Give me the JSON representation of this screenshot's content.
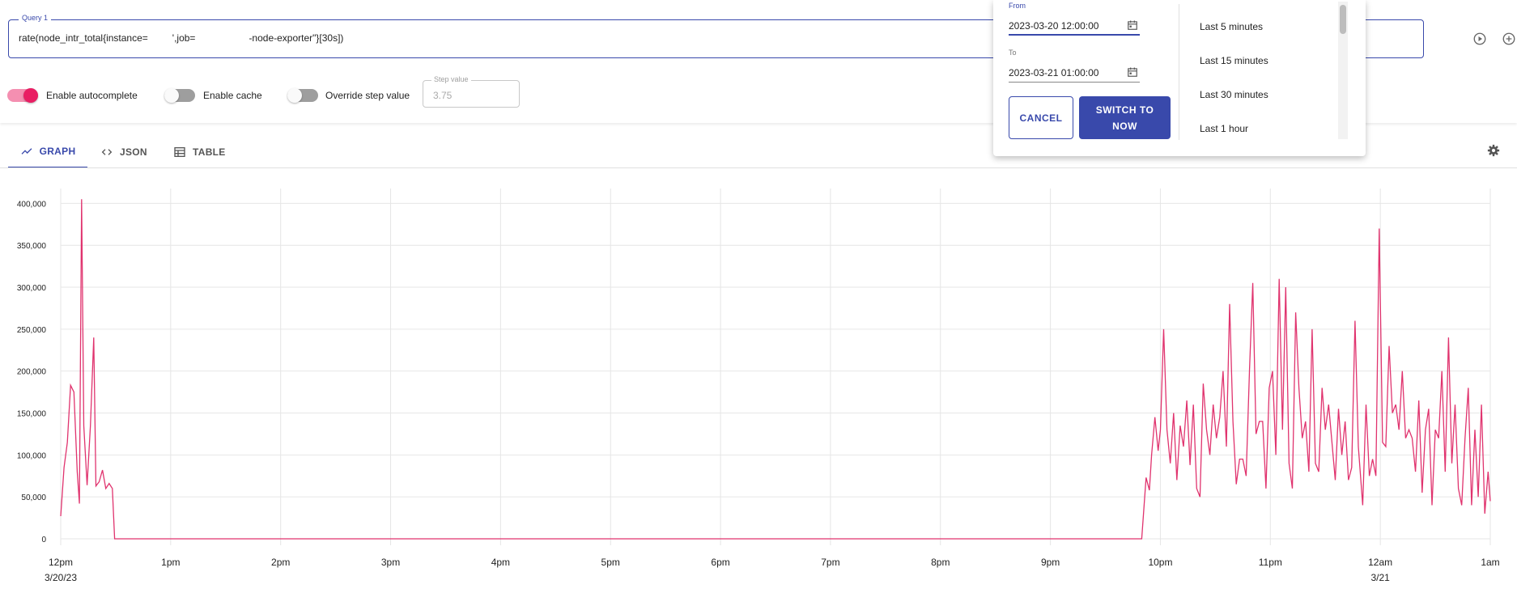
{
  "query": {
    "label": "Query 1",
    "expression_parts": [
      "rate(node_intr_total{instance=",
      "',job=",
      "-node-exporter\"}[30s])"
    ]
  },
  "options": {
    "autocomplete_label": "Enable autocomplete",
    "autocomplete_on": true,
    "cache_label": "Enable cache",
    "cache_on": false,
    "override_step_label": "Override step value",
    "override_step_on": false,
    "step_value_label": "Step value",
    "step_value_placeholder": "3.75"
  },
  "tabs": [
    {
      "label": "GRAPH",
      "icon": "trending-up-icon",
      "active": true
    },
    {
      "label": "JSON",
      "icon": "code-icon",
      "active": false
    },
    {
      "label": "TABLE",
      "icon": "table-icon",
      "active": false
    }
  ],
  "time_picker": {
    "from_label": "From",
    "from_value": "2023-03-20 12:00:00",
    "to_label": "To",
    "to_value": "2023-03-21 01:00:00",
    "cancel_label": "CANCEL",
    "switch_label": "SWITCH TO NOW",
    "ranges": [
      "Last 5 minutes",
      "Last 15 minutes",
      "Last 30 minutes",
      "Last 1 hour"
    ]
  },
  "colors": {
    "accent": "#3949ab",
    "series": "#e0336e",
    "toggle_on": "#f06292",
    "toggle_on_knob": "#e91e63"
  },
  "chart_data": {
    "type": "line",
    "ylim": [
      0,
      410000
    ],
    "yticks": [
      0,
      50000,
      100000,
      150000,
      200000,
      250000,
      300000,
      350000,
      400000
    ],
    "ytick_labels": [
      "0",
      "50,000",
      "100,000",
      "150,000",
      "200,000",
      "250,000",
      "300,000",
      "350,000",
      "400,000"
    ],
    "xlim_hours": [
      0,
      13
    ],
    "xtick_labels": [
      {
        "h": 0,
        "label": "12pm",
        "sub": "3/20/23"
      },
      {
        "h": 1,
        "label": "1pm",
        "sub": ""
      },
      {
        "h": 2,
        "label": "2pm",
        "sub": ""
      },
      {
        "h": 3,
        "label": "3pm",
        "sub": ""
      },
      {
        "h": 4,
        "label": "4pm",
        "sub": ""
      },
      {
        "h": 5,
        "label": "5pm",
        "sub": ""
      },
      {
        "h": 6,
        "label": "6pm",
        "sub": ""
      },
      {
        "h": 7,
        "label": "7pm",
        "sub": ""
      },
      {
        "h": 8,
        "label": "8pm",
        "sub": ""
      },
      {
        "h": 9,
        "label": "9pm",
        "sub": ""
      },
      {
        "h": 10,
        "label": "10pm",
        "sub": ""
      },
      {
        "h": 11,
        "label": "11pm",
        "sub": ""
      },
      {
        "h": 12,
        "label": "12am",
        "sub": "3/21"
      },
      {
        "h": 13,
        "label": "1am",
        "sub": ""
      }
    ],
    "grid": true,
    "series": [
      {
        "points": [
          [
            0.0,
            27000
          ],
          [
            0.03,
            85000
          ],
          [
            0.06,
            115000
          ],
          [
            0.09,
            183000
          ],
          [
            0.12,
            175000
          ],
          [
            0.15,
            80000
          ],
          [
            0.17,
            42000
          ],
          [
            0.19,
            405000
          ],
          [
            0.21,
            135000
          ],
          [
            0.24,
            64000
          ],
          [
            0.27,
            135000
          ],
          [
            0.3,
            240000
          ],
          [
            0.32,
            63000
          ],
          [
            0.35,
            68000
          ],
          [
            0.38,
            82000
          ],
          [
            0.41,
            60000
          ],
          [
            0.44,
            66000
          ],
          [
            0.47,
            60000
          ],
          [
            0.49,
            0
          ],
          [
            9.83,
            0
          ],
          [
            9.87,
            73000
          ],
          [
            9.9,
            58000
          ],
          [
            9.92,
            100000
          ],
          [
            9.95,
            145000
          ],
          [
            9.98,
            105000
          ],
          [
            10.0,
            130000
          ],
          [
            10.03,
            250000
          ],
          [
            10.06,
            130000
          ],
          [
            10.09,
            90000
          ],
          [
            10.12,
            150000
          ],
          [
            10.15,
            70000
          ],
          [
            10.18,
            135000
          ],
          [
            10.21,
            110000
          ],
          [
            10.24,
            165000
          ],
          [
            10.27,
            88000
          ],
          [
            10.3,
            160000
          ],
          [
            10.33,
            60000
          ],
          [
            10.36,
            50000
          ],
          [
            10.39,
            185000
          ],
          [
            10.42,
            130000
          ],
          [
            10.45,
            100000
          ],
          [
            10.48,
            160000
          ],
          [
            10.51,
            120000
          ],
          [
            10.54,
            145000
          ],
          [
            10.57,
            200000
          ],
          [
            10.6,
            110000
          ],
          [
            10.63,
            280000
          ],
          [
            10.66,
            140000
          ],
          [
            10.69,
            65000
          ],
          [
            10.72,
            95000
          ],
          [
            10.75,
            95000
          ],
          [
            10.78,
            75000
          ],
          [
            10.81,
            200000
          ],
          [
            10.84,
            305000
          ],
          [
            10.87,
            125000
          ],
          [
            10.9,
            140000
          ],
          [
            10.93,
            140000
          ],
          [
            10.96,
            60000
          ],
          [
            10.99,
            180000
          ],
          [
            11.02,
            200000
          ],
          [
            11.05,
            100000
          ],
          [
            11.08,
            310000
          ],
          [
            11.11,
            130000
          ],
          [
            11.14,
            300000
          ],
          [
            11.17,
            90000
          ],
          [
            11.2,
            60000
          ],
          [
            11.23,
            270000
          ],
          [
            11.26,
            180000
          ],
          [
            11.29,
            120000
          ],
          [
            11.32,
            140000
          ],
          [
            11.35,
            80000
          ],
          [
            11.38,
            250000
          ],
          [
            11.41,
            90000
          ],
          [
            11.44,
            80000
          ],
          [
            11.47,
            180000
          ],
          [
            11.5,
            130000
          ],
          [
            11.53,
            160000
          ],
          [
            11.56,
            115000
          ],
          [
            11.59,
            70000
          ],
          [
            11.62,
            155000
          ],
          [
            11.65,
            100000
          ],
          [
            11.68,
            140000
          ],
          [
            11.71,
            70000
          ],
          [
            11.74,
            85000
          ],
          [
            11.77,
            260000
          ],
          [
            11.8,
            110000
          ],
          [
            11.84,
            40000
          ],
          [
            11.87,
            160000
          ],
          [
            11.9,
            75000
          ],
          [
            11.93,
            95000
          ],
          [
            11.96,
            75000
          ],
          [
            11.99,
            370000
          ],
          [
            12.02,
            115000
          ],
          [
            12.05,
            110000
          ],
          [
            12.08,
            230000
          ],
          [
            12.11,
            150000
          ],
          [
            12.14,
            160000
          ],
          [
            12.17,
            130000
          ],
          [
            12.2,
            200000
          ],
          [
            12.23,
            120000
          ],
          [
            12.26,
            130000
          ],
          [
            12.29,
            120000
          ],
          [
            12.32,
            80000
          ],
          [
            12.35,
            165000
          ],
          [
            12.38,
            55000
          ],
          [
            12.41,
            130000
          ],
          [
            12.44,
            155000
          ],
          [
            12.47,
            40000
          ],
          [
            12.5,
            130000
          ],
          [
            12.53,
            120000
          ],
          [
            12.56,
            200000
          ],
          [
            12.59,
            80000
          ],
          [
            12.62,
            240000
          ],
          [
            12.65,
            90000
          ],
          [
            12.68,
            160000
          ],
          [
            12.71,
            60000
          ],
          [
            12.74,
            40000
          ],
          [
            12.77,
            120000
          ],
          [
            12.8,
            180000
          ],
          [
            12.83,
            40000
          ],
          [
            12.86,
            130000
          ],
          [
            12.89,
            50000
          ],
          [
            12.92,
            160000
          ],
          [
            12.95,
            30000
          ],
          [
            12.98,
            80000
          ],
          [
            13.0,
            45000
          ]
        ]
      }
    ]
  }
}
